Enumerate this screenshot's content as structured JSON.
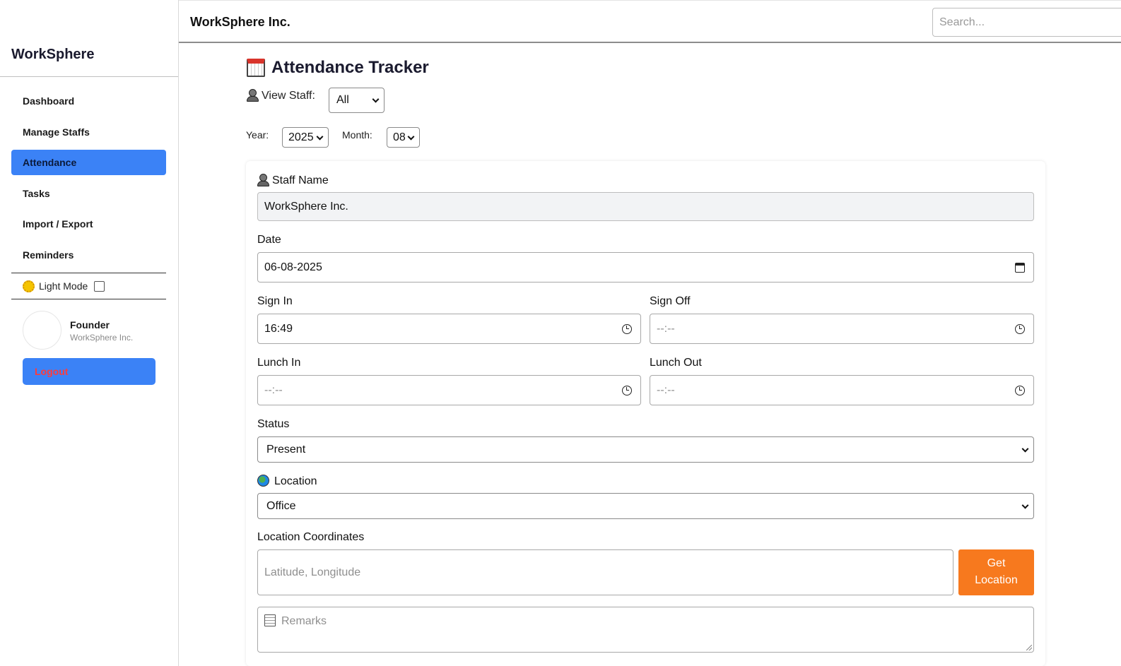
{
  "sidebar": {
    "brand": "WorkSphere",
    "nav": [
      {
        "label": "Dashboard"
      },
      {
        "label": "Manage Staffs"
      },
      {
        "label": "Attendance",
        "active": true
      },
      {
        "label": "Tasks"
      },
      {
        "label": "Import / Export"
      },
      {
        "label": "Reminders"
      }
    ],
    "theme_toggle": {
      "label": "Light Mode",
      "checked": false,
      "icon": "sun-icon"
    },
    "user": {
      "role": "Founder",
      "org": "WorkSphere Inc."
    },
    "logout_label": "Logout"
  },
  "topbar": {
    "title": "WorkSphere Inc.",
    "search_placeholder": "Search..."
  },
  "page": {
    "title": "Attendance Tracker",
    "view_staff_label": "View Staff:",
    "view_staff_value": "All",
    "year_label": "Year:",
    "year_value": "2025",
    "month_label": "Month:",
    "month_value": "08"
  },
  "form": {
    "staff_name_label": "Staff Name",
    "staff_name_value": "WorkSphere Inc.",
    "date_label": "Date",
    "date_value": "06-08-2025",
    "sign_in_label": "Sign In",
    "sign_in_value": "16:49",
    "sign_off_label": "Sign Off",
    "sign_off_value": "--:--",
    "lunch_in_label": "Lunch In",
    "lunch_in_value": "--:--",
    "lunch_out_label": "Lunch Out",
    "lunch_out_value": "--:--",
    "status_label": "Status",
    "status_value": "Present",
    "location_label": "Location",
    "location_value": "Office",
    "coords_label": "Location Coordinates",
    "coords_placeholder": "Latitude, Longitude",
    "get_location_label": "Get Location",
    "remarks_placeholder": "Remarks"
  },
  "colors": {
    "accent": "#3b82f6",
    "logout_text": "#ff3b3b",
    "get_location_bg": "#f7791e"
  }
}
